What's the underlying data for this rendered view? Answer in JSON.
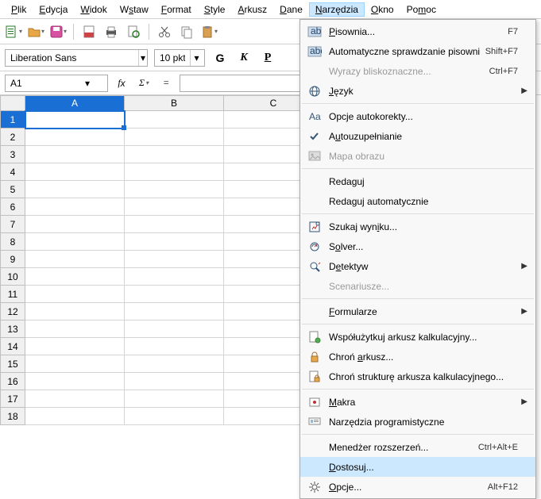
{
  "menubar": {
    "items": [
      {
        "label": "Plik",
        "u": 0
      },
      {
        "label": "Edycja",
        "u": 0
      },
      {
        "label": "Widok",
        "u": 0
      },
      {
        "label": "Wstaw",
        "u": 1
      },
      {
        "label": "Format",
        "u": 0
      },
      {
        "label": "Style",
        "u": 0
      },
      {
        "label": "Arkusz",
        "u": 0
      },
      {
        "label": "Dane",
        "u": 0
      },
      {
        "label": "Narzędzia",
        "u": 0,
        "open": true
      },
      {
        "label": "Okno",
        "u": 0
      },
      {
        "label": "Pomoc",
        "u": 2
      }
    ]
  },
  "formatbar": {
    "font_name": "Liberation Sans",
    "font_size": "10 pkt",
    "bold": "G",
    "italic": "K",
    "underline": "P"
  },
  "formulabar": {
    "cell_ref": "A1",
    "formula": ""
  },
  "grid": {
    "cols": [
      "A",
      "B",
      "C"
    ],
    "rows": [
      "1",
      "2",
      "3",
      "4",
      "5",
      "6",
      "7",
      "8",
      "9",
      "10",
      "11",
      "12",
      "13",
      "14",
      "15",
      "16",
      "17",
      "18"
    ],
    "active_col": 0,
    "active_row": 0
  },
  "menu": {
    "items": [
      {
        "icon": "abc-check",
        "label": "Pisownia...",
        "u": 0,
        "accel": "F7"
      },
      {
        "icon": "abc-auto",
        "label": "Automatyczne sprawdzanie pisowni",
        "u": -1,
        "accel": "Shift+F7"
      },
      {
        "icon": "",
        "label": "Wyrazy bliskoznaczne...",
        "u": -1,
        "accel": "Ctrl+F7",
        "disabled": true
      },
      {
        "icon": "globe",
        "label": "Język",
        "u": 0,
        "sub": true
      },
      {
        "sep": true
      },
      {
        "icon": "aa",
        "label": "Opcje autokorekty...",
        "u": -1
      },
      {
        "icon": "check",
        "label": "Autouzupełnianie",
        "u": 1
      },
      {
        "icon": "image",
        "label": "Mapa obrazu",
        "u": -1,
        "disabled": true
      },
      {
        "sep": true
      },
      {
        "icon": "",
        "label": "Redaguj",
        "u": -1
      },
      {
        "icon": "",
        "label": "Redaguj automatycznie",
        "u": -1
      },
      {
        "sep": true
      },
      {
        "icon": "target",
        "label": "Szukaj wyniku...",
        "u": 10
      },
      {
        "icon": "solver",
        "label": "Solver...",
        "u": 1
      },
      {
        "icon": "detective",
        "label": "Detektyw",
        "u": 1,
        "sub": true
      },
      {
        "icon": "",
        "label": "Scenariusze...",
        "u": -1,
        "disabled": true
      },
      {
        "sep": true
      },
      {
        "icon": "",
        "label": "Formularze",
        "u": 0,
        "sub": true
      },
      {
        "sep": true
      },
      {
        "icon": "share",
        "label": "Współużytkuj arkusz kalkulacyjny...",
        "u": -1
      },
      {
        "icon": "lock",
        "label": "Chroń arkusz...",
        "u": 6
      },
      {
        "icon": "lock-doc",
        "label": "Chroń strukturę arkusza kalkulacyjnego...",
        "u": -1
      },
      {
        "sep": true
      },
      {
        "icon": "macro",
        "label": "Makra",
        "u": 0,
        "sub": true
      },
      {
        "icon": "dev",
        "label": "Narzędzia programistyczne",
        "u": -1
      },
      {
        "sep": true
      },
      {
        "icon": "",
        "label": "Menedżer rozszerzeń...",
        "u": -1,
        "accel": "Ctrl+Alt+E"
      },
      {
        "icon": "",
        "label": "Dostosuj...",
        "u": 0,
        "hover": true
      },
      {
        "icon": "gear",
        "label": "Opcje...",
        "u": 0,
        "accel": "Alt+F12"
      }
    ]
  }
}
